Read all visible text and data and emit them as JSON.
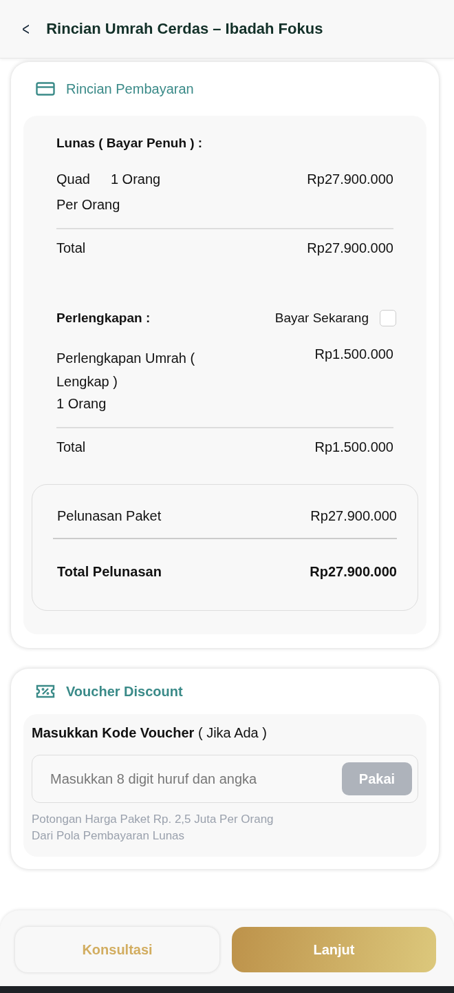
{
  "header": {
    "back": "<",
    "title": "Rincian Umrah Cerdas – Ibadah Fokus"
  },
  "payment": {
    "title": "Rincian Pembayaran",
    "package": {
      "heading": "Lunas ( Bayar Penuh ) :",
      "items": [
        {
          "name": "Quad",
          "qty": "1 Orang",
          "price": "Rp27.900.000",
          "unit": "Per Orang"
        }
      ],
      "total_label": "Total",
      "total_value": "Rp27.900.000"
    },
    "equipment": {
      "heading": "Perlengkapan :",
      "pay_now": {
        "label": "Bayar Sekarang",
        "checked": false
      },
      "items": [
        {
          "name": "Perlengkapan Umrah ( Lengkap )",
          "qty": "1 Orang",
          "price": "Rp1.500.000"
        }
      ],
      "total_label": "Total",
      "total_value": "Rp1.500.000"
    },
    "summary": [
      {
        "label": "Pelunasan Paket",
        "value": "Rp27.900.000",
        "kind": "line"
      },
      {
        "label": "Total Pelunasan",
        "value": "Rp27.900.000",
        "kind": "total"
      }
    ]
  },
  "voucher": {
    "title": "Voucher Discount",
    "label": "**Masukkan Kode Voucher** ( Jika Ada )",
    "placeholder": "Masukkan 8 digit huruf dan angka",
    "apply": {
      "label": "Pakai",
      "disabled": true
    },
    "hint": [
      "Potongan Harga Paket Rp. 2,5 Juta Per Orang",
      "Dari Pola Pembayaran Lunas"
    ]
  },
  "footer": {
    "buttons": [
      {
        "label": "Konsultasi",
        "kind": "secondary"
      },
      {
        "label": "Lanjut",
        "kind": "primary"
      }
    ]
  }
}
